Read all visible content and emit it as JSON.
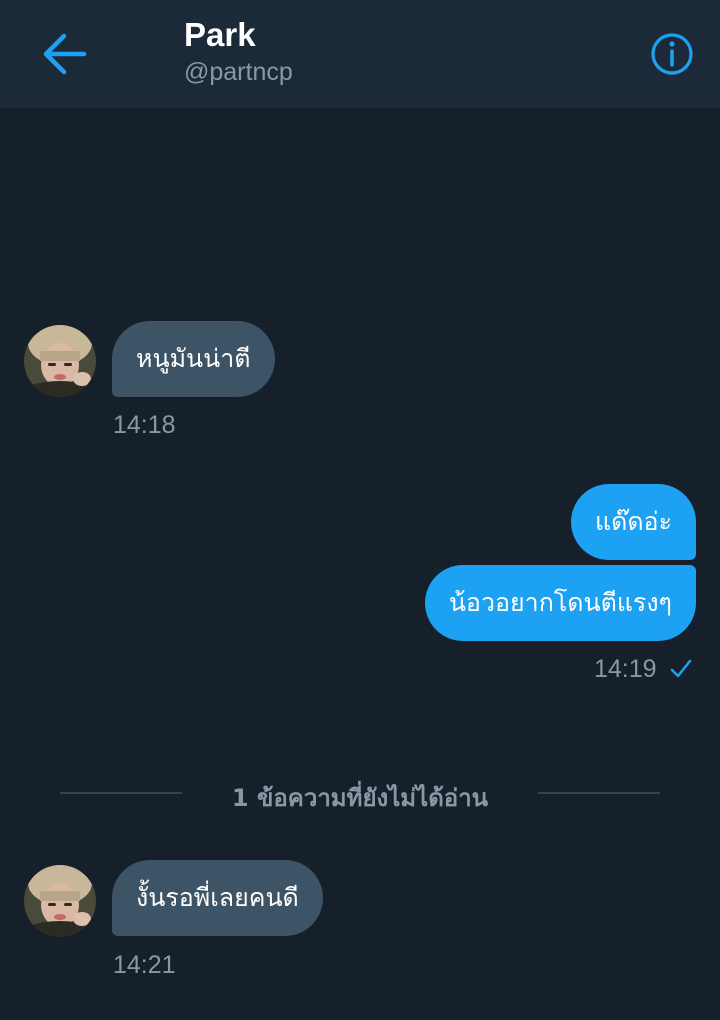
{
  "header": {
    "name": "Park",
    "handle": "@partncp",
    "back_icon": "arrow-left-icon",
    "info_icon": "info-icon",
    "accent_color": "#1da1f2"
  },
  "messages": [
    {
      "sender": "them",
      "text": "หนูมันน่าตี",
      "time": "14:18"
    },
    {
      "sender": "me",
      "text": "แด๊ดอ่ะ"
    },
    {
      "sender": "me",
      "text": "น้อวอยากโดนตีแรงๆ",
      "time": "14:19",
      "status": "sent-check-icon"
    },
    {
      "sender": "them",
      "text": "งั้นรอพี่เลยคนดี",
      "time": "14:21"
    }
  ],
  "unread_divider": "1 ข้อความที่ยังไม่ได้อ่าน",
  "colors": {
    "background": "#15202b",
    "header_bg": "#1c2938",
    "incoming_bubble": "#3d5466",
    "outgoing_bubble": "#1da1f2",
    "muted_text": "#8899a6"
  }
}
